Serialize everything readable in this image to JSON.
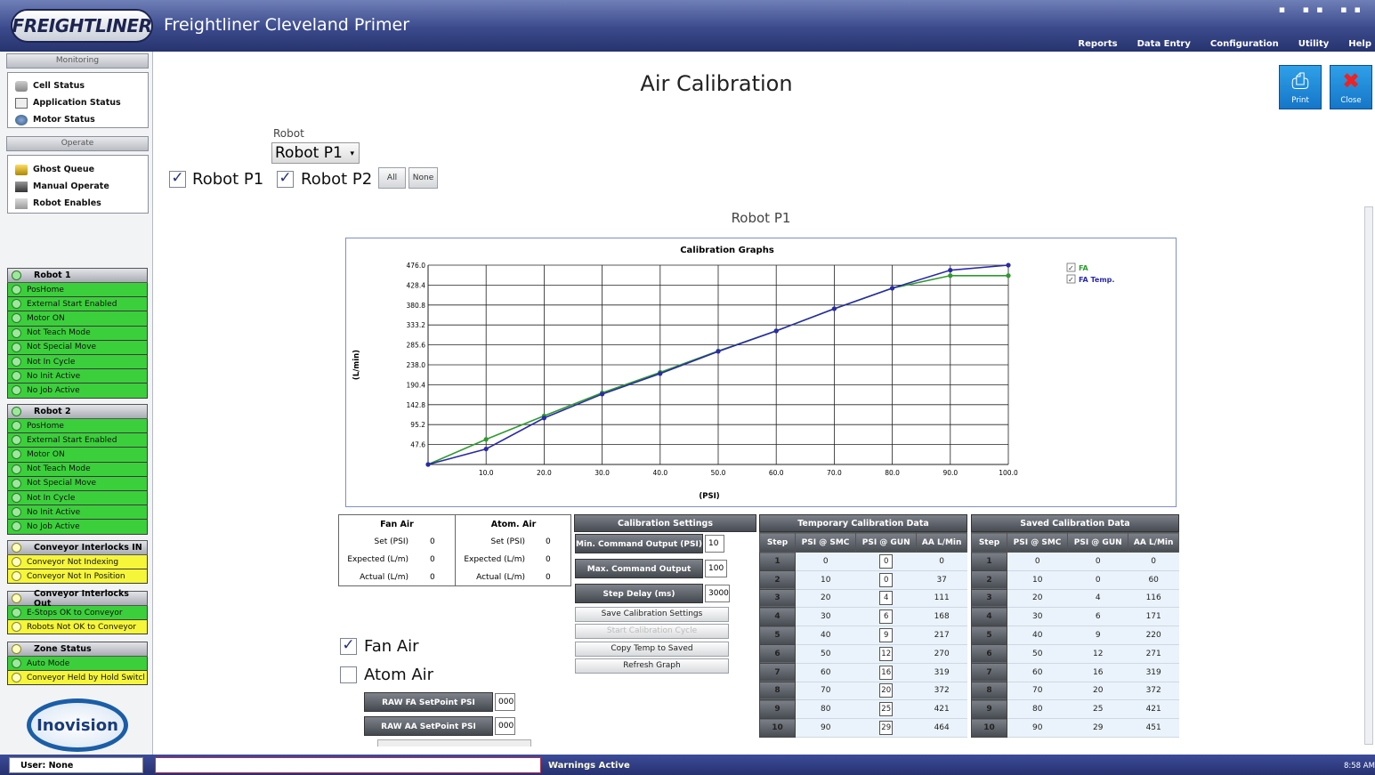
{
  "window": {
    "brand": "FREIGHTLINER",
    "title": "Freightliner Cleveland Primer"
  },
  "menu": [
    "Reports",
    "Data Entry",
    "Configuration",
    "Utility",
    "Help"
  ],
  "nav": {
    "monitoring_header": "Monitoring",
    "monitoring_items": [
      "Cell Status",
      "Application Status",
      "Motor Status"
    ],
    "operate_header": "Operate",
    "operate_items": [
      "Ghost Queue",
      "Manual Operate",
      "Robot Enables"
    ]
  },
  "status_groups": [
    {
      "title": "Robot 1",
      "color": "green",
      "rows": [
        "PosHome",
        "External Start Enabled",
        "Motor ON",
        "Not Teach Mode",
        "Not Special Move",
        "Not In Cycle",
        "No Init Active",
        "No Job Active"
      ]
    },
    {
      "title": "Robot 2",
      "color": "green",
      "rows": [
        "PosHome",
        "External Start Enabled",
        "Motor ON",
        "Not Teach Mode",
        "Not Special Move",
        "Not In Cycle",
        "No Init Active",
        "No Job Active"
      ]
    },
    {
      "title": "Conveyor Interlocks IN",
      "color": "yellow",
      "rows": [
        "Conveyor Not Indexing",
        "Conveyor Not In Position"
      ]
    },
    {
      "title": "Conveyor Interlocks Out",
      "color": "mixed",
      "rows": [
        "E-Stops OK to Conveyor",
        "Robots Not OK to Conveyor"
      ],
      "row_colors": [
        "green",
        "yellow"
      ]
    },
    {
      "title": "Zone Status",
      "color": "mixed",
      "rows": [
        "Auto Mode",
        "Conveyor Held by Hold Switcl"
      ],
      "row_colors": [
        "green",
        "yellow"
      ]
    }
  ],
  "logo_text": "Inovision",
  "page": {
    "title": "Air Calibration",
    "print_label": "Print",
    "close_label": "Close",
    "robot_label": "Robot",
    "robot_selected": "Robot P1",
    "robot_p1": "Robot P1",
    "robot_p2": "Robot P2",
    "all_label": "All",
    "none_label": "None",
    "subtitle": "Robot P1"
  },
  "chart_data": {
    "type": "line",
    "title": "Calibration Graphs",
    "xlabel": "(PSI)",
    "ylabel": "(L/min)",
    "x": [
      0,
      10,
      20,
      30,
      40,
      50,
      60,
      70,
      80,
      90,
      100
    ],
    "xticks": [
      "10.0",
      "20.0",
      "30.0",
      "40.0",
      "50.0",
      "60.0",
      "70.0",
      "80.0",
      "90.0",
      "100.0"
    ],
    "yticks": [
      "47.6",
      "95.2",
      "142.8",
      "190.4",
      "238.0",
      "285.6",
      "333.2",
      "380.8",
      "428.4",
      "476.0"
    ],
    "xlim": [
      0,
      100
    ],
    "ylim": [
      0,
      476
    ],
    "grid": true,
    "legend_position": "top-right",
    "series": [
      {
        "name": "FA",
        "color": "#2e9a2e",
        "values": [
          0,
          60,
          116,
          171,
          220,
          271,
          319,
          372,
          421,
          451,
          451
        ]
      },
      {
        "name": "FA Temp.",
        "color": "#2a2aa8",
        "values": [
          0,
          37,
          111,
          168,
          217,
          270,
          319,
          372,
          421,
          464,
          476
        ]
      }
    ]
  },
  "fan_air": {
    "title": "Fan Air",
    "set_label": "Set (PSI)",
    "set": "0",
    "expected_label": "Expected (L/m)",
    "expected": "0",
    "actual_label": "Actual (L/m)",
    "actual": "0"
  },
  "atom_air": {
    "title": "Atom. Air",
    "set_label": "Set (PSI)",
    "set": "0",
    "expected_label": "Expected (L/m)",
    "expected": "0",
    "actual_label": "Actual (L/m)",
    "actual": "0"
  },
  "calibration": {
    "header": "Calibration Settings",
    "min_label": "Min. Command Output (PSI)",
    "min_value": "10",
    "max_label": "Max. Command Output (PSI)",
    "max_value": "100",
    "delay_label": "Step Delay (ms)",
    "delay_value": "3000",
    "save_label": "Save Calibration Settings",
    "start_label": "Start Calibration Cycle",
    "copy_label": "Copy Temp to Saved",
    "refresh_label": "Refresh Graph"
  },
  "fan_air_check": "Fan Air",
  "atom_air_check": "Atom Air",
  "raw_fa": {
    "label": "RAW FA SetPoint PSI",
    "value": "000"
  },
  "raw_aa": {
    "label": "RAW AA SetPoint PSI",
    "value": "000"
  },
  "temp_data": {
    "header": "Temporary Calibration Data",
    "columns": [
      "Step",
      "PSI @ SMC",
      "PSI @ GUN",
      "AA L/Min"
    ],
    "rows": [
      [
        "1",
        "0",
        "0",
        "0"
      ],
      [
        "2",
        "10",
        "0",
        "37"
      ],
      [
        "3",
        "20",
        "4",
        "111"
      ],
      [
        "4",
        "30",
        "6",
        "168"
      ],
      [
        "5",
        "40",
        "9",
        "217"
      ],
      [
        "6",
        "50",
        "12",
        "270"
      ],
      [
        "7",
        "60",
        "16",
        "319"
      ],
      [
        "8",
        "70",
        "20",
        "372"
      ],
      [
        "9",
        "80",
        "25",
        "421"
      ],
      [
        "10",
        "90",
        "29",
        "464"
      ]
    ]
  },
  "saved_data": {
    "header": "Saved Calibration Data",
    "columns": [
      "Step",
      "PSI @ SMC",
      "PSI @ GUN",
      "AA L/Min"
    ],
    "rows": [
      [
        "1",
        "0",
        "0",
        "0"
      ],
      [
        "2",
        "10",
        "0",
        "60"
      ],
      [
        "3",
        "20",
        "4",
        "116"
      ],
      [
        "4",
        "30",
        "6",
        "171"
      ],
      [
        "5",
        "40",
        "9",
        "220"
      ],
      [
        "6",
        "50",
        "12",
        "271"
      ],
      [
        "7",
        "60",
        "16",
        "319"
      ],
      [
        "8",
        "70",
        "20",
        "372"
      ],
      [
        "9",
        "80",
        "25",
        "421"
      ],
      [
        "10",
        "90",
        "29",
        "451"
      ]
    ]
  },
  "statusbar": {
    "user": "User:  None",
    "warnings": "Warnings Active",
    "clock": "8:58 AM"
  }
}
